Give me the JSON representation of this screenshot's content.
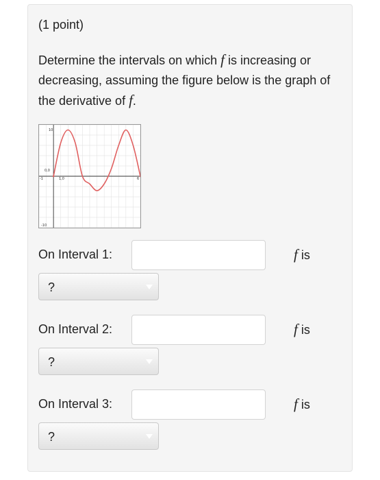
{
  "problem": {
    "points": "(1 point)",
    "question_pre": "Determine the intervals on which ",
    "question_f1": "f",
    "question_mid": " is increasing or decreasing, assuming the figure below is the graph of the derivative of ",
    "question_f2": "f",
    "question_end": "."
  },
  "graph": {
    "y_max_label": "10",
    "y_min_label": "-10",
    "x_min_label": "-1",
    "x_max_label": "6",
    "point_a_label": "0,0",
    "point_b_label": "1,0",
    "curve_color": "#e06060",
    "axis_color": "#333333",
    "grid_color": "#dddddd"
  },
  "chart_data": {
    "type": "line",
    "title": "",
    "xlabel": "",
    "ylabel": "",
    "xlim": [
      -1,
      6
    ],
    "ylim": [
      -10,
      10
    ],
    "x": [
      0,
      0.5,
      1,
      1.5,
      2,
      2.5,
      3,
      3.5,
      4,
      4.5,
      5,
      5.5,
      6
    ],
    "series": [
      {
        "values": [
          0,
          6.5,
          9,
          6.5,
          0,
          -1.5,
          -2.8,
          -1.5,
          1.5,
          6,
          9,
          6,
          0
        ]
      }
    ]
  },
  "intervals": [
    {
      "label": "On Interval 1:",
      "input_value": "",
      "f_symbol": "f",
      "is_text": " is",
      "select_value": "?"
    },
    {
      "label": "On Interval 2:",
      "input_value": "",
      "f_symbol": "f",
      "is_text": " is",
      "select_value": "?"
    },
    {
      "label": "On Interval 3:",
      "input_value": "",
      "f_symbol": "f",
      "is_text": " is",
      "select_value": "?"
    }
  ]
}
